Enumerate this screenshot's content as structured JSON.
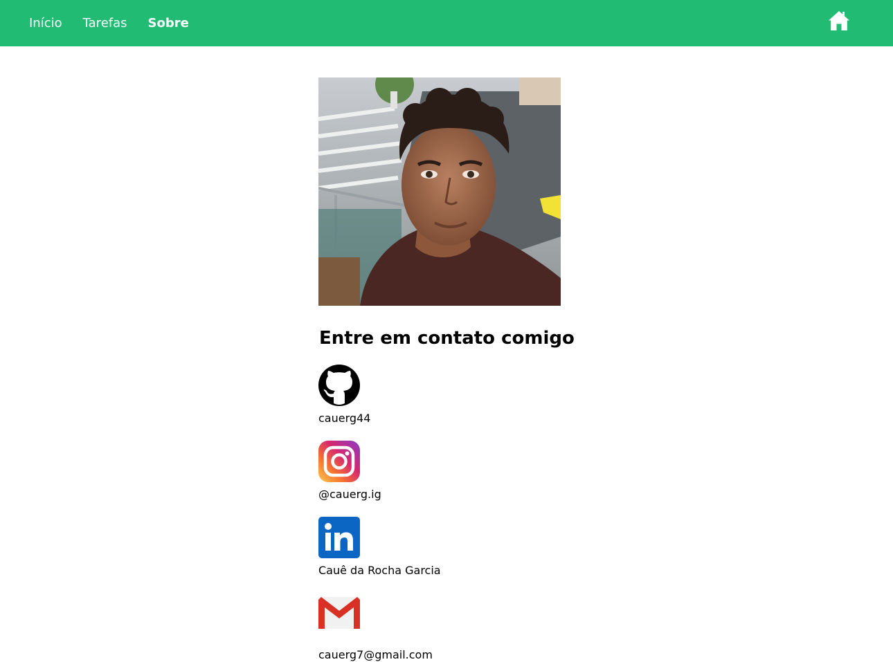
{
  "nav": {
    "links": [
      {
        "label": "Início"
      },
      {
        "label": "Tarefas"
      },
      {
        "label": "Sobre"
      }
    ],
    "active": "Sobre",
    "home_icon": "house-icon"
  },
  "colors": {
    "navbar": "#22bb73",
    "text": "#000000",
    "nav_text": "#ffffff",
    "linkedin": "#0a66c2",
    "gmail": "#d93025"
  },
  "profile": {
    "photo": "profile-photo"
  },
  "contact": {
    "heading": "Entre em contato comigo",
    "items": [
      {
        "icon": "github-icon",
        "label": "cauerg44"
      },
      {
        "icon": "instagram-icon",
        "label": "@cauerg.ig"
      },
      {
        "icon": "linkedin-icon",
        "label": "Cauê da Rocha Garcia"
      },
      {
        "icon": "gmail-icon",
        "label": "cauerg7@gmail.com"
      }
    ]
  }
}
